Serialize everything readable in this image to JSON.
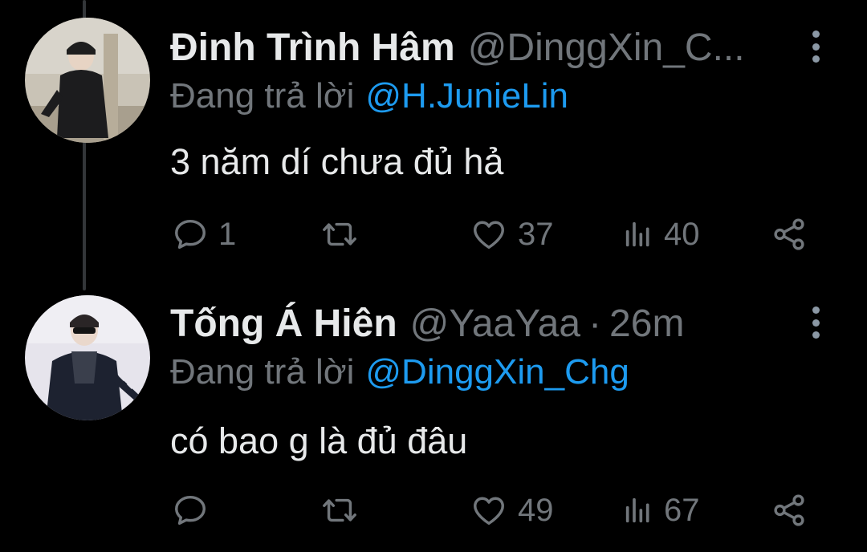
{
  "thread": [
    {
      "display_name": "Đinh Trình Hâm",
      "handle": "@DinggXin_C...",
      "timestamp": "",
      "reply_prefix": "Đang trả lời",
      "reply_to": "@H.JunieLin",
      "text": "3 năm dí chưa đủ hả",
      "replies": "1",
      "retweets": "",
      "likes": "37",
      "views": "40",
      "avatar_icon": "user-avatar-photo"
    },
    {
      "display_name": "Tống Á Hiên",
      "handle": "@YaaYaa",
      "separator": "·",
      "timestamp": "26m",
      "reply_prefix": "Đang trả lời",
      "reply_to": "@DinggXin_Chg",
      "text": "có bao g là đủ đâu",
      "replies": "",
      "retweets": "",
      "likes": "49",
      "views": "67",
      "avatar_icon": "user-avatar-photo"
    }
  ],
  "icons": {
    "reply": "reply-icon",
    "retweet": "retweet-icon",
    "like": "heart-icon",
    "views": "views-icon",
    "share": "share-icon",
    "more": "more-options-icon"
  },
  "colors": {
    "background": "#000000",
    "primary_text": "#e7e9ea",
    "secondary_text": "#71767b",
    "accent": "#1d9bf0",
    "thread_line": "#333639"
  }
}
